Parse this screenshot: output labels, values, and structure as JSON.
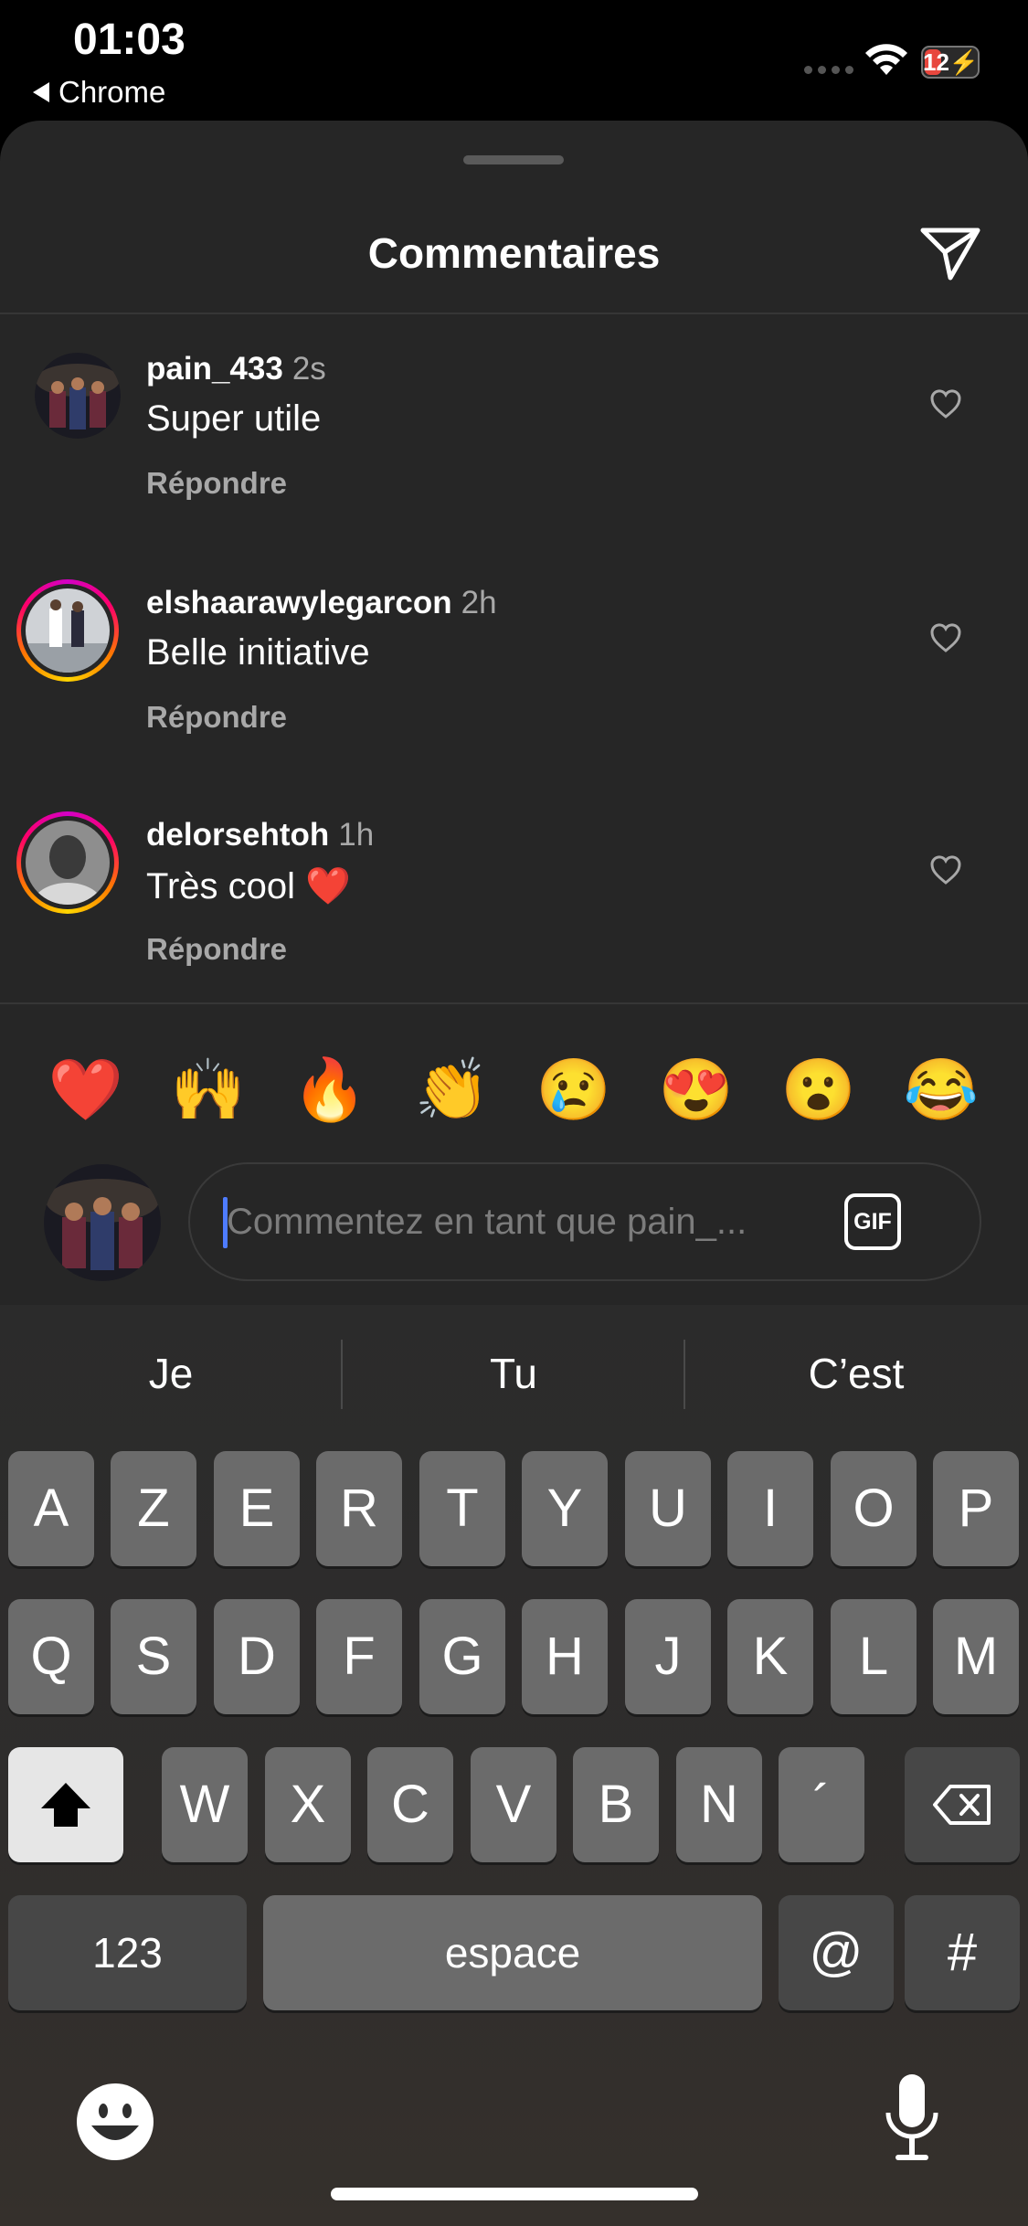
{
  "status_bar": {
    "time": "01:03",
    "back_app": "Chrome",
    "battery_level": "12",
    "battery_state": "charging",
    "icons": [
      "cellular-signal-icon",
      "wifi-icon",
      "battery-icon"
    ]
  },
  "sheet": {
    "title": "Commentaires",
    "share_icon": "paper-plane-icon"
  },
  "comments": [
    {
      "username": "pain_433",
      "ago": "2s",
      "text": "Super utile",
      "reply_label": "Répondre",
      "has_story_ring": false
    },
    {
      "username": "elshaarawylegarcon",
      "ago": "2h",
      "text": "Belle initiative",
      "reply_label": "Répondre",
      "has_story_ring": true
    },
    {
      "username": "delorsehtoh",
      "ago": "1h",
      "text": "Très cool ❤️",
      "reply_label": "Répondre",
      "has_story_ring": true
    }
  ],
  "quick_reactions": [
    "❤️",
    "🙌",
    "🔥",
    "👏",
    "😢",
    "😍",
    "😮",
    "😂"
  ],
  "composer": {
    "placeholder": "Commentez en tant que pain_...",
    "gif_label": "GIF"
  },
  "keyboard": {
    "suggestions": [
      "Je",
      "Tu",
      "C’est"
    ],
    "row1": [
      "A",
      "Z",
      "E",
      "R",
      "T",
      "Y",
      "U",
      "I",
      "O",
      "P"
    ],
    "row2": [
      "Q",
      "S",
      "D",
      "F",
      "G",
      "H",
      "J",
      "K",
      "L",
      "M"
    ],
    "row3": [
      "W",
      "X",
      "C",
      "V",
      "B",
      "N",
      "´"
    ],
    "numbers_label": "123",
    "space_label": "espace",
    "at_label": "@",
    "hash_label": "#"
  },
  "colors": {
    "background": "#000000",
    "sheet": "#262626",
    "secondary_text": "#a8a8a8",
    "caret": "#4e7cff",
    "battery_low": "#e8473e"
  }
}
